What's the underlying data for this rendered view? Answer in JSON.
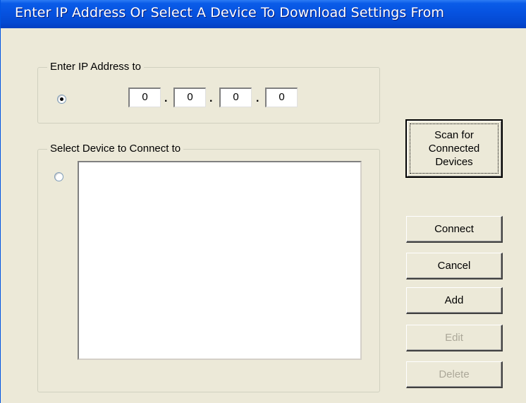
{
  "window": {
    "title": "Enter IP Address Or Select A Device To Download Settings From"
  },
  "ip_group": {
    "legend": "Enter IP Address to",
    "radio_selected": true,
    "octets": [
      "0",
      "0",
      "0",
      "0"
    ],
    "separator": "."
  },
  "device_group": {
    "legend": "Select Device to Connect to",
    "radio_selected": false,
    "devices": []
  },
  "buttons": {
    "scan": "Scan for\nConnected\nDevices",
    "connect": "Connect",
    "cancel": "Cancel",
    "add": "Add",
    "edit": "Edit",
    "delete": "Delete"
  },
  "button_states": {
    "edit_enabled": false,
    "delete_enabled": false
  }
}
